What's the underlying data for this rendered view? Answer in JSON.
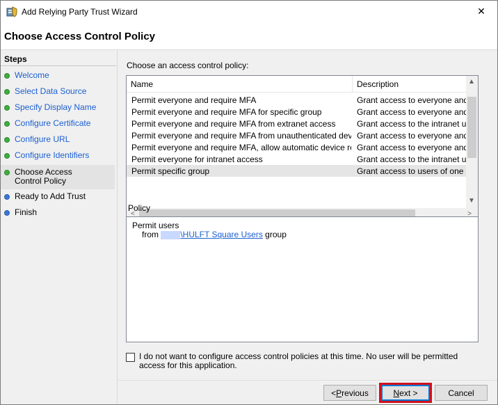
{
  "window": {
    "title": "Add Relying Party Trust Wizard",
    "close_glyph": "✕"
  },
  "header": {
    "title": "Choose Access Control Policy"
  },
  "steps": {
    "heading": "Steps",
    "items": [
      {
        "label": "Welcome",
        "status": "done"
      },
      {
        "label": "Select Data Source",
        "status": "done"
      },
      {
        "label": "Specify Display Name",
        "status": "done"
      },
      {
        "label": "Configure Certificate",
        "status": "done"
      },
      {
        "label": "Configure URL",
        "status": "done"
      },
      {
        "label": "Configure Identifiers",
        "status": "done"
      },
      {
        "label": "Choose Access Control Policy",
        "status": "current"
      },
      {
        "label": "Ready to Add Trust",
        "status": "pending"
      },
      {
        "label": "Finish",
        "status": "pending"
      }
    ]
  },
  "policy_list": {
    "prompt": "Choose an access control policy:",
    "columns": [
      "Name",
      "Description"
    ],
    "rows": [
      {
        "name": "Permit everyone and require MFA",
        "description": "Grant access to everyone and requir"
      },
      {
        "name": "Permit everyone and require MFA for specific group",
        "description": "Grant access to everyone and requir"
      },
      {
        "name": "Permit everyone and require MFA from extranet access",
        "description": "Grant access to the intranet users ar"
      },
      {
        "name": "Permit everyone and require MFA from unauthenticated devices",
        "description": "Grant access to everyone and requir"
      },
      {
        "name": "Permit everyone and require MFA, allow automatic device registr...",
        "description": "Grant access to everyone and requir"
      },
      {
        "name": "Permit everyone for intranet access",
        "description": "Grant access to the intranet users."
      },
      {
        "name": "Permit specific group",
        "description": "Grant access to users of one or more"
      }
    ],
    "selected_index": 6
  },
  "policy": {
    "label": "Policy",
    "line1": "Permit users",
    "from": "from",
    "group_link": "\\HULFT Square Users",
    "group_suffix": "group"
  },
  "opt_out": {
    "checked": false,
    "text": "I do not want to configure access control policies at this time. No user will be permitted access for this application."
  },
  "buttons": {
    "previous_pre": "< ",
    "previous_accel": "P",
    "previous_rest": "revious",
    "next_accel": "N",
    "next_rest": "ext >",
    "cancel": "Cancel"
  },
  "colors": {
    "done": "#3fae3f",
    "pending": "#3b78d6",
    "highlight": "#d0101a",
    "link": "#1c5fd1"
  }
}
